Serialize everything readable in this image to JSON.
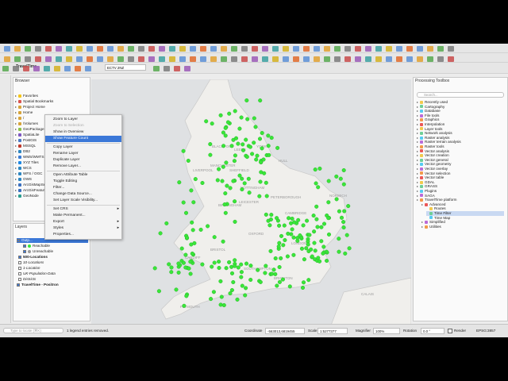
{
  "colors": {
    "accent": "#3b78d8",
    "point": "#39e639",
    "land": "#f0efec",
    "sea": "#dfe1e3"
  },
  "toolbar": {
    "scale_field": "ECTV 2NZ",
    "brand_label": "TravelTime",
    "icons": [
      "new-project-icon",
      "open-icon",
      "save-icon",
      "pan-icon",
      "zoom-in-icon",
      "zoom-out-icon",
      "select-icon",
      "identify-icon",
      "measure-icon",
      "sum-icon",
      "text-annotation-icon",
      "python-icon",
      "digitize-icon"
    ]
  },
  "browser": {
    "title": "Browser",
    "items": [
      {
        "label": "Favorites",
        "icon": "star-icon"
      },
      {
        "label": "Spatial Bookmarks",
        "icon": "bookmark-icon"
      },
      {
        "label": "Project Home",
        "icon": "folder-icon"
      },
      {
        "label": "Home",
        "icon": "folder-icon"
      },
      {
        "label": "/",
        "icon": "folder-icon"
      },
      {
        "label": "/Volumes",
        "icon": "folder-icon"
      },
      {
        "label": "GeoPackage",
        "icon": "geopackage-icon"
      },
      {
        "label": "SpatiaLite",
        "icon": "spatialite-icon"
      },
      {
        "label": "PostGIS",
        "icon": "postgis-icon"
      },
      {
        "label": "MSSQL",
        "icon": "mssql-icon"
      },
      {
        "label": "DB2",
        "icon": "db2-icon"
      },
      {
        "label": "WMS/WMTS",
        "icon": "wms-icon"
      },
      {
        "label": "XYZ Tiles",
        "icon": "xyz-icon"
      },
      {
        "label": "WCS",
        "icon": "wcs-icon"
      },
      {
        "label": "WFS / OGC",
        "icon": "wfs-icon"
      },
      {
        "label": "OWS",
        "icon": "ows-icon"
      },
      {
        "label": "ArcGisMapServer",
        "icon": "arcgis-icon"
      },
      {
        "label": "ArcGisFeatureServer",
        "icon": "arcgis-icon"
      },
      {
        "label": "GeoNode",
        "icon": "geonode-icon"
      }
    ]
  },
  "layers": {
    "title": "Layers",
    "items": [
      {
        "label": "Outp...",
        "checked": true,
        "selected": true
      },
      {
        "label": "Reachable",
        "checked": true,
        "selected": false
      },
      {
        "label": "Unreachable",
        "checked": true,
        "selected": false
      },
      {
        "label": "500-Locations",
        "checked": true,
        "selected": false
      },
      {
        "label": "10-Locations",
        "checked": false,
        "selected": false
      },
      {
        "label": "1-Location",
        "checked": false,
        "selected": false
      },
      {
        "label": "UK-Population-Data",
        "checked": false,
        "selected": false
      },
      {
        "label": "Districts",
        "checked": false,
        "selected": false
      },
      {
        "label": "TravelTime - Positron",
        "checked": true,
        "selected": false
      }
    ]
  },
  "context_menu": {
    "items": [
      {
        "label": "Zoom to Layer",
        "disabled": false,
        "highlight": false,
        "submenu": false
      },
      {
        "label": "Zoom to Selection",
        "disabled": true,
        "highlight": false,
        "submenu": false
      },
      {
        "label": "Show in Overview",
        "disabled": false,
        "highlight": false,
        "submenu": false
      },
      {
        "label": "Show Feature Count",
        "disabled": false,
        "highlight": true,
        "submenu": false
      },
      {
        "label": "Copy Layer",
        "disabled": false,
        "highlight": false,
        "submenu": false
      },
      {
        "label": "Rename Layer",
        "disabled": false,
        "highlight": false,
        "submenu": false
      },
      {
        "label": "Duplicate Layer",
        "disabled": false,
        "highlight": false,
        "submenu": false
      },
      {
        "label": "Remove Layer...",
        "disabled": false,
        "highlight": false,
        "submenu": false
      },
      {
        "label": "Open Attribute Table",
        "disabled": false,
        "highlight": false,
        "submenu": false
      },
      {
        "label": "Toggle Editing",
        "disabled": false,
        "highlight": false,
        "submenu": false
      },
      {
        "label": "Filter...",
        "disabled": false,
        "highlight": false,
        "submenu": false
      },
      {
        "label": "Change Data Source...",
        "disabled": false,
        "highlight": false,
        "submenu": false
      },
      {
        "label": "Set Layer Scale Visibility...",
        "disabled": false,
        "highlight": false,
        "submenu": false
      },
      {
        "label": "Set CRS",
        "disabled": false,
        "highlight": false,
        "submenu": true
      },
      {
        "label": "Make Permanent...",
        "disabled": false,
        "highlight": false,
        "submenu": false
      },
      {
        "label": "Export",
        "disabled": false,
        "highlight": false,
        "submenu": true
      },
      {
        "label": "Styles",
        "disabled": false,
        "highlight": false,
        "submenu": true
      },
      {
        "label": "Properties...",
        "disabled": false,
        "highlight": false,
        "submenu": false
      }
    ]
  },
  "map": {
    "labels": [
      "BLACKPOOL",
      "LEEDS",
      "YORK",
      "HULL",
      "MANCHESTER",
      "SHEFFIELD",
      "LIVERPOOL",
      "NOTTINGHAM",
      "LEICESTER",
      "BIRMINGHAM",
      "PETERBOROUGH",
      "NORWICH",
      "CAMBRIDGE",
      "OXFORD",
      "LONDON",
      "BRISTOL",
      "CARDIFF",
      "SOUTHAMPTON",
      "BRIGHTON",
      "PLYMOUTH",
      "CALAIS"
    ]
  },
  "processing": {
    "title": "Processing Toolbox",
    "search_placeholder": "Search...",
    "items": [
      {
        "label": "Recently used",
        "indent": 0,
        "selected": false
      },
      {
        "label": "Cartography",
        "indent": 0,
        "selected": false
      },
      {
        "label": "Database",
        "indent": 0,
        "selected": false
      },
      {
        "label": "File tools",
        "indent": 0,
        "selected": false
      },
      {
        "label": "Graphics",
        "indent": 0,
        "selected": false
      },
      {
        "label": "Interpolation",
        "indent": 0,
        "selected": false
      },
      {
        "label": "Layer tools",
        "indent": 0,
        "selected": false
      },
      {
        "label": "Network analysis",
        "indent": 0,
        "selected": false
      },
      {
        "label": "Raster analysis",
        "indent": 0,
        "selected": false
      },
      {
        "label": "Raster terrain analysis",
        "indent": 0,
        "selected": false
      },
      {
        "label": "Raster tools",
        "indent": 0,
        "selected": false
      },
      {
        "label": "Vector analysis",
        "indent": 0,
        "selected": false
      },
      {
        "label": "Vector creation",
        "indent": 0,
        "selected": false
      },
      {
        "label": "Vector general",
        "indent": 0,
        "selected": false
      },
      {
        "label": "Vector geometry",
        "indent": 0,
        "selected": false
      },
      {
        "label": "Vector overlay",
        "indent": 0,
        "selected": false
      },
      {
        "label": "Vector selection",
        "indent": 0,
        "selected": false
      },
      {
        "label": "Vector table",
        "indent": 0,
        "selected": false
      },
      {
        "label": "GDAL",
        "indent": 0,
        "selected": false
      },
      {
        "label": "GRASS",
        "indent": 0,
        "selected": false
      },
      {
        "label": "Plugins",
        "indent": 0,
        "selected": false
      },
      {
        "label": "SAGA",
        "indent": 0,
        "selected": false
      },
      {
        "label": "TravelTime platform",
        "indent": 0,
        "selected": false
      },
      {
        "label": "Advanced",
        "indent": 1,
        "selected": false
      },
      {
        "label": "Routes",
        "indent": 2,
        "selected": false
      },
      {
        "label": "Time Filter",
        "indent": 2,
        "selected": true
      },
      {
        "label": "Time Map",
        "indent": 2,
        "selected": false
      },
      {
        "label": "Simplified",
        "indent": 1,
        "selected": false
      },
      {
        "label": "Utilities",
        "indent": 1,
        "selected": false
      }
    ]
  },
  "status": {
    "locate_placeholder": "Type to locate (⌘K)",
    "message": "1 legend entries removed.",
    "coordinate_label": "Coordinate",
    "coordinate_value": "-563013,6819455",
    "scale_label": "Scale",
    "scale_value": "1:5277377",
    "magnifier_label": "Magnifier",
    "magnifier_value": "100%",
    "rotation_label": "Rotation",
    "rotation_value": "0.0 °",
    "render_label": "Render",
    "crs_label": "EPSG:3857"
  }
}
